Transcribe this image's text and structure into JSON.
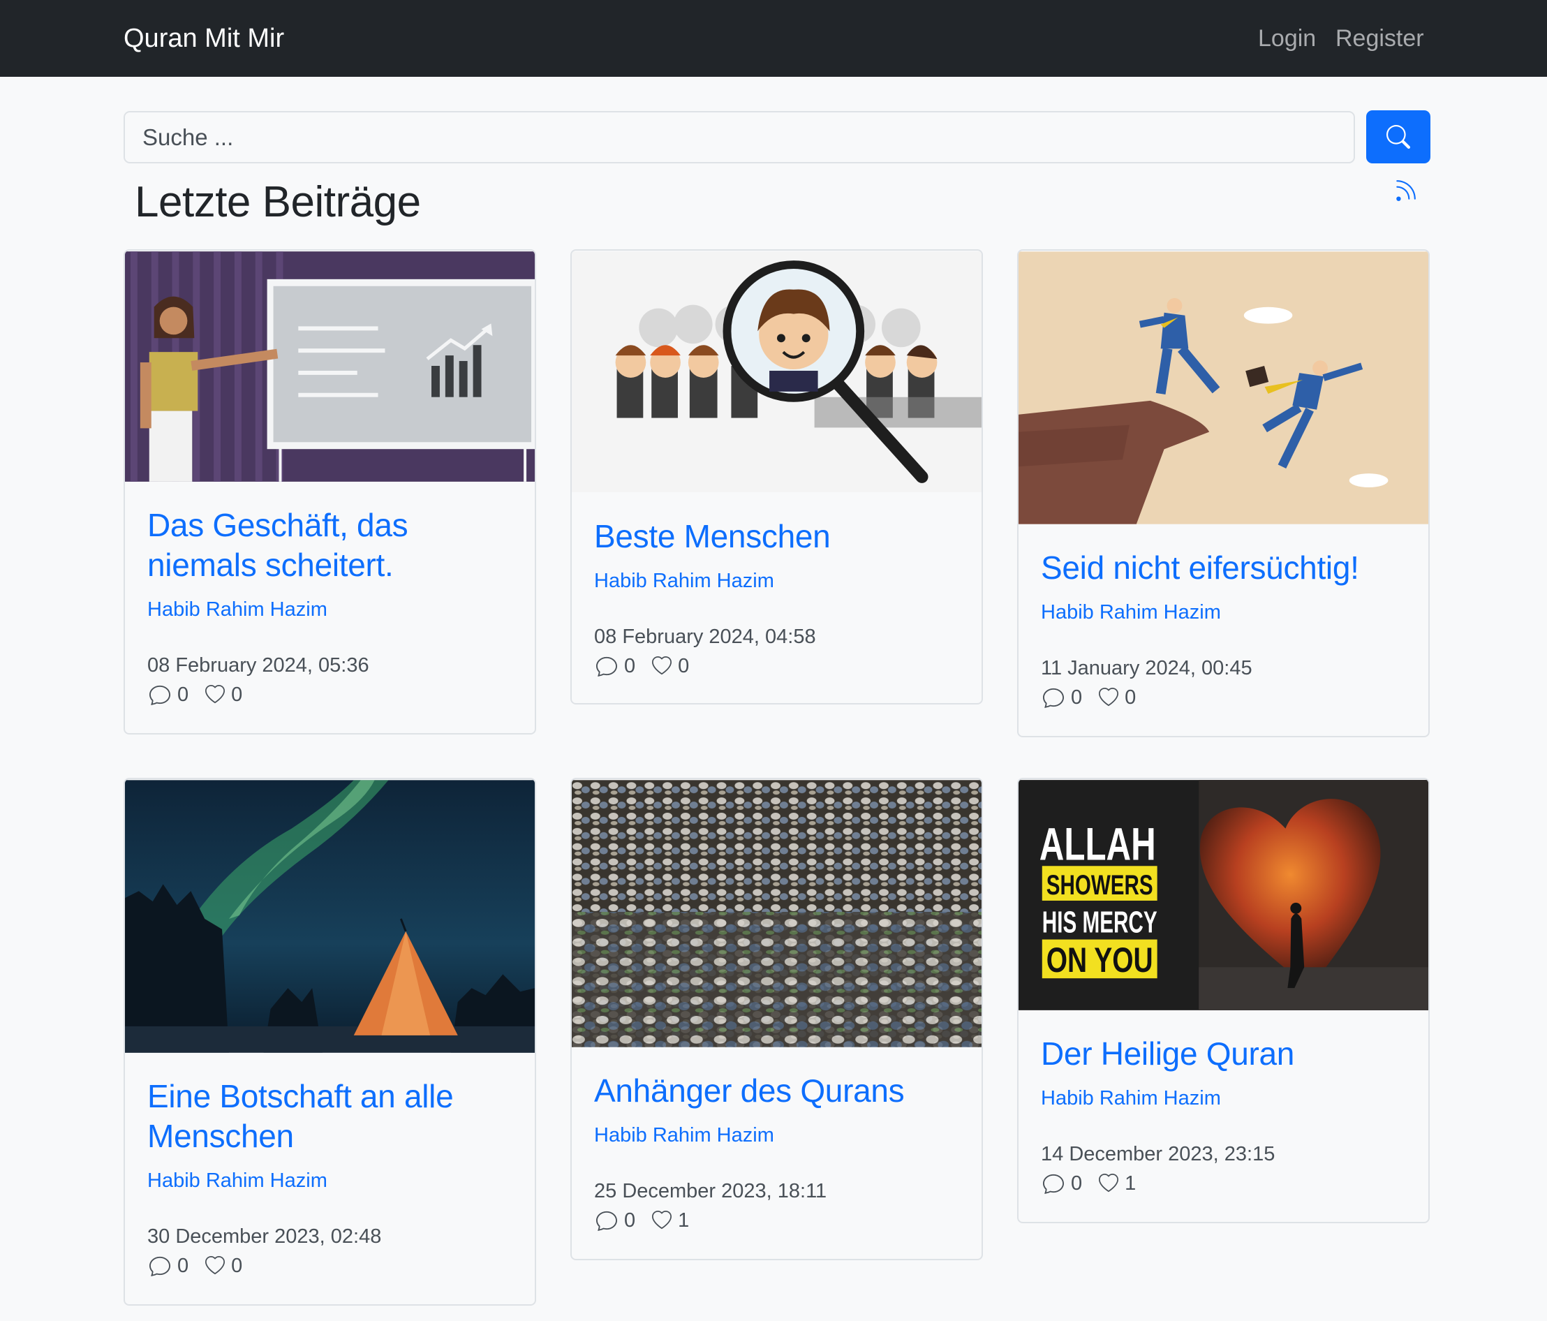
{
  "navbar": {
    "brand": "Quran Mit Mir",
    "login": "Login",
    "register": "Register"
  },
  "search": {
    "placeholder": "Suche ..."
  },
  "section": {
    "title": "Letzte Beiträge"
  },
  "colors": {
    "accent": "#0d6efd",
    "navbar": "#212529",
    "background": "#f8f9fa"
  },
  "posts": [
    {
      "title": "Das Geschäft, das niemals scheitert.",
      "author": "Habib Rahim Hazim",
      "date": "08 February 2024, 05:36",
      "comments": "0",
      "likes": "0"
    },
    {
      "title": "Beste Menschen",
      "author": "Habib Rahim Hazim",
      "date": "08 February 2024, 04:58",
      "comments": "0",
      "likes": "0"
    },
    {
      "title": "Seid nicht eifersüchtig!",
      "author": "Habib Rahim Hazim",
      "date": "11 January 2024, 00:45",
      "comments": "0",
      "likes": "0"
    },
    {
      "title": "Eine Botschaft an alle Menschen",
      "author": "Habib Rahim Hazim",
      "date": "30 December 2023, 02:48",
      "comments": "0",
      "likes": "0"
    },
    {
      "title": "Anhänger des Qurans",
      "author": "Habib Rahim Hazim",
      "date": "25 December 2023, 18:11",
      "comments": "0",
      "likes": "1"
    },
    {
      "title": "Der Heilige Quran",
      "author": "Habib Rahim Hazim",
      "date": "14 December 2023, 23:15",
      "comments": "0",
      "likes": "1",
      "image_text": [
        "ALLAH",
        "SHOWERS",
        "HIS MERCY",
        "ON YOU"
      ]
    }
  ]
}
